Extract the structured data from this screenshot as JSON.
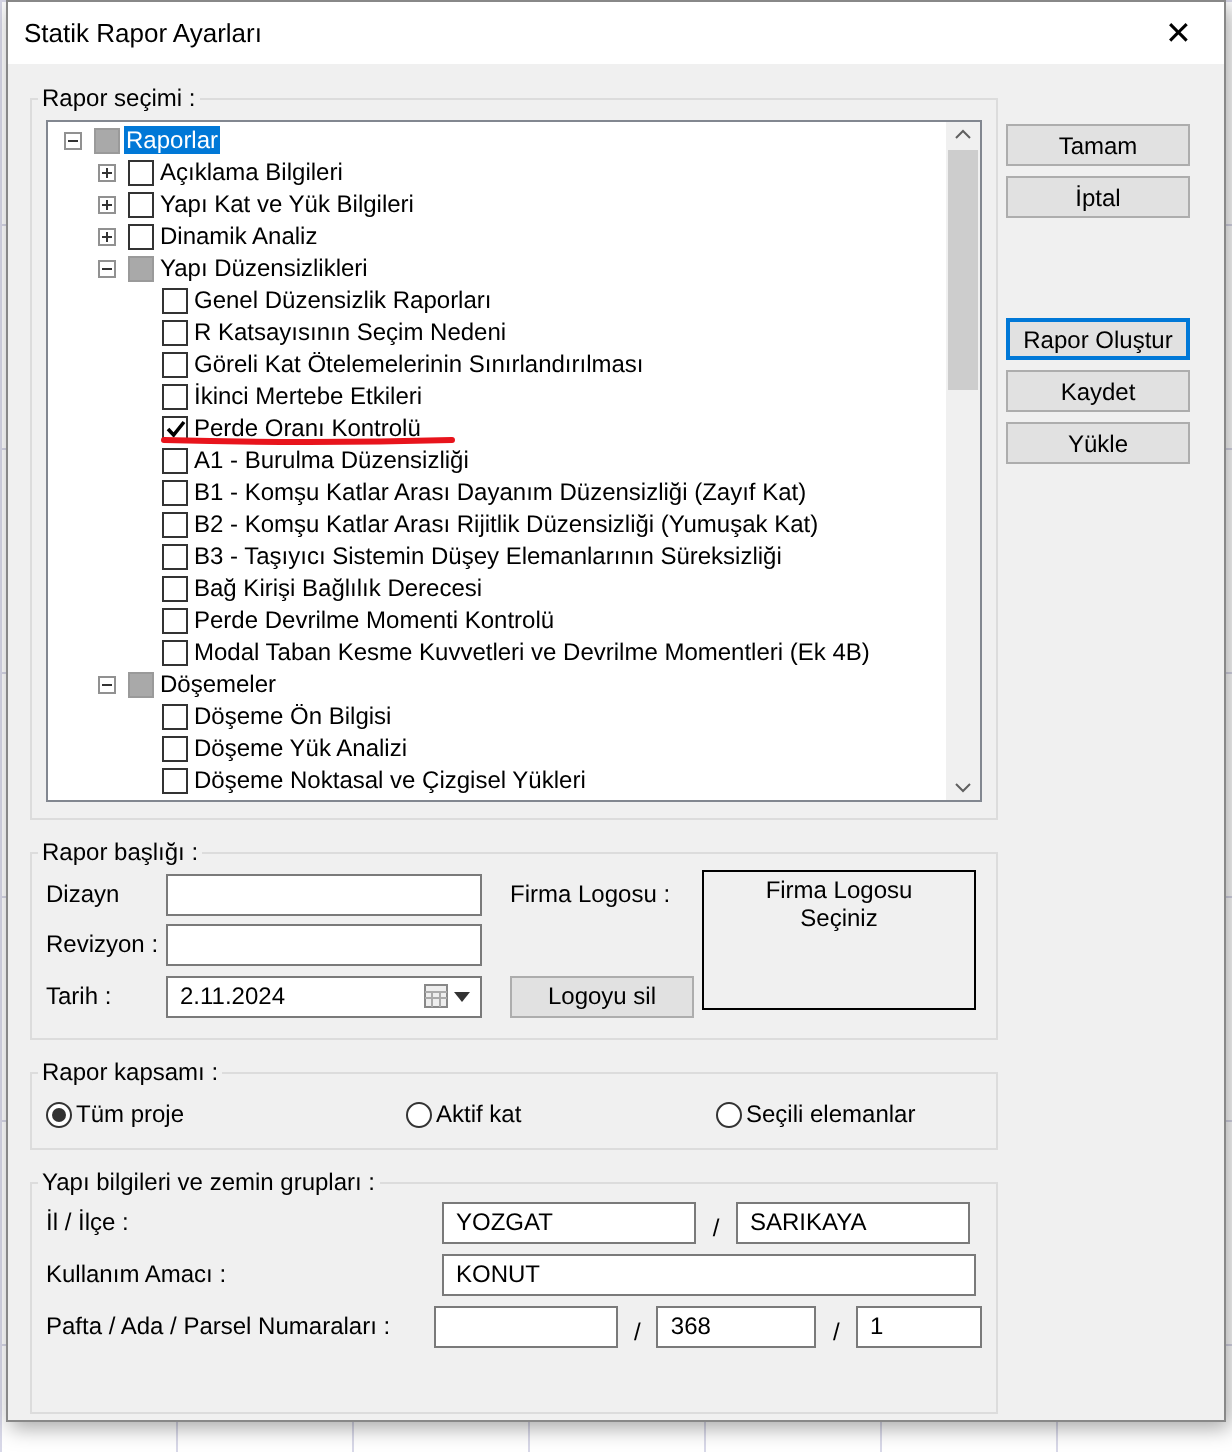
{
  "window": {
    "title": "Statik Rapor Ayarları",
    "close": "✕"
  },
  "report_selection": {
    "label": "Rapor seçimi :",
    "tree": [
      {
        "label": "Raporlar",
        "checked": false,
        "partial": true,
        "expanded": true,
        "selected": true,
        "children": [
          {
            "label": "Açıklama Bilgileri",
            "checked": false,
            "partial": false,
            "expanded": false,
            "selected": false
          },
          {
            "label": "Yapı Kat ve Yük Bilgileri",
            "checked": false,
            "partial": false,
            "expanded": false,
            "selected": false
          },
          {
            "label": "Dinamik Analiz",
            "checked": false,
            "partial": false,
            "expanded": false,
            "selected": false
          },
          {
            "label": "Yapı Düzensizlikleri",
            "checked": false,
            "partial": true,
            "expanded": true,
            "selected": false,
            "children": [
              {
                "label": "Genel Düzensizlik Raporları",
                "checked": false,
                "selected": false
              },
              {
                "label": "R Katsayısının Seçim Nedeni",
                "checked": false,
                "selected": false
              },
              {
                "label": "Göreli Kat Ötelemelerinin Sınırlandırılması",
                "checked": false,
                "selected": false
              },
              {
                "label": "İkinci Mertebe Etkileri",
                "checked": false,
                "selected": false
              },
              {
                "label": "Perde Oranı Kontrolü",
                "checked": true,
                "selected": false
              },
              {
                "label": "A1 - Burulma Düzensizliği",
                "checked": false,
                "selected": false
              },
              {
                "label": "B1 - Komşu Katlar Arası Dayanım Düzensizliği (Zayıf Kat)",
                "checked": false,
                "selected": false
              },
              {
                "label": "B2 - Komşu Katlar Arası Rijitlik Düzensizliği (Yumuşak Kat)",
                "checked": false,
                "selected": false
              },
              {
                "label": "B3 - Taşıyıcı Sistemin Düşey Elemanlarının Süreksizliği",
                "checked": false,
                "selected": false
              },
              {
                "label": "Bağ Kirişi Bağlılık Derecesi",
                "checked": false,
                "selected": false
              },
              {
                "label": "Perde Devrilme Momenti Kontrolü",
                "checked": false,
                "selected": false
              },
              {
                "label": "Modal Taban Kesme Kuvvetleri ve Devrilme Momentleri  (Ek 4B)",
                "checked": false,
                "selected": false
              }
            ]
          },
          {
            "label": "Döşemeler",
            "checked": false,
            "partial": true,
            "expanded": true,
            "selected": false,
            "children": [
              {
                "label": "Döşeme Ön Bilgisi",
                "checked": false,
                "selected": false
              },
              {
                "label": "Döşeme Yük Analizi",
                "checked": false,
                "selected": false
              },
              {
                "label": "Döşeme Noktasal ve Çizgisel Yükleri",
                "checked": false,
                "selected": false
              }
            ]
          }
        ]
      }
    ]
  },
  "buttons": [
    {
      "label": "Tamam",
      "focused": false
    },
    {
      "label": "İptal",
      "focused": false
    },
    {
      "label": "Rapor Oluştur",
      "focused": true
    },
    {
      "label": "Kaydet",
      "focused": false
    },
    {
      "label": "Yükle",
      "focused": false
    }
  ],
  "report_header": {
    "label": "Rapor başlığı :",
    "fields": [
      {
        "label": "Dizayn"
      },
      {
        "label": "Revizyon :"
      }
    ],
    "date": {
      "label": "Tarih :",
      "value": "2.11.2024"
    },
    "logo_label": "Firma Logosu :",
    "logo_placeholder": "Firma Logosu\nSeçiniz",
    "remove_logo": "Logoyu sil"
  },
  "report_scope": {
    "label": "Rapor kapsamı :",
    "options": [
      {
        "label": "Tüm proje",
        "selected": true
      },
      {
        "label": "Aktif kat",
        "selected": false
      },
      {
        "label": "Seçili elemanlar",
        "selected": false
      }
    ]
  },
  "building_info": {
    "label": "Yapı bilgileri ve zemin grupları :",
    "rows": [
      {
        "label": "İl / İlçe :",
        "kind": "pair",
        "values": [
          {
            "kind": "text",
            "value": "YOZGAT"
          },
          {
            "kind": "text",
            "value": "SARIKAYA"
          }
        ],
        "separator": "/"
      },
      {
        "label": "Kullanım Amacı :",
        "kind": "single",
        "values": [
          {
            "kind": "text",
            "value": "KONUT"
          }
        ]
      },
      {
        "label": "Pafta / Ada / Parsel Numaraları :",
        "kind": "triple",
        "values": [
          {
            "kind": "blank"
          },
          {
            "kind": "text",
            "value": "368"
          },
          {
            "kind": "text",
            "value": "1"
          }
        ],
        "separator": "/"
      }
    ]
  }
}
